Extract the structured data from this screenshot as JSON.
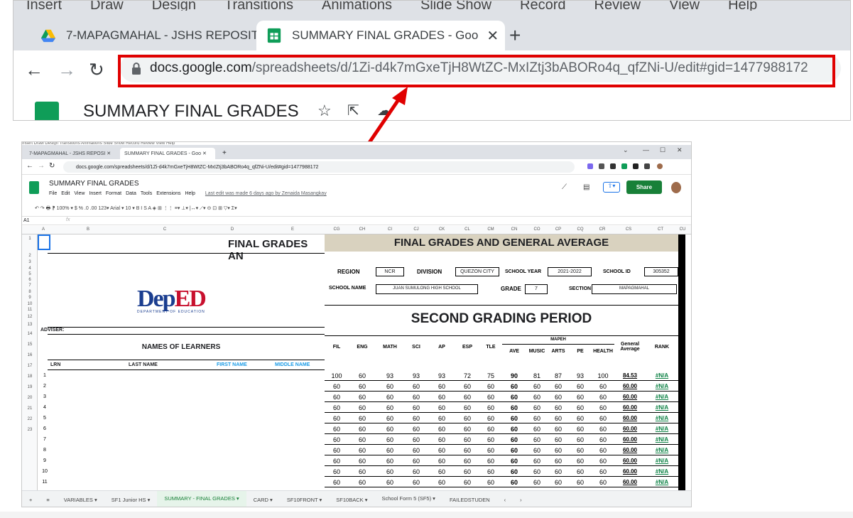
{
  "zoom": {
    "menu_strip": [
      "Insert",
      "Draw",
      "Design",
      "Transitions",
      "Animations",
      "Slide Show",
      "Record",
      "Review",
      "View",
      "Help"
    ],
    "tabs": [
      {
        "label": "7-MAPAGMAHAL - JSHS REPOSIT",
        "close": "✕"
      },
      {
        "label": "SUMMARY FINAL GRADES - Goo",
        "close": "✕"
      }
    ],
    "new_tab": "+",
    "nav": {
      "back": "←",
      "forward": "→",
      "reload": "↻"
    },
    "url_host": "docs.google.com",
    "url_path": "/spreadsheets/d/1Zi-d4k7mGxeTjH8WtZC-MxIZtj3bABORo4q_qfZNi-U/edit#gid=1477988172",
    "doc_title": "SUMMARY FINAL GRADES",
    "doc_icons": [
      "☆",
      "⇱",
      "☁"
    ]
  },
  "shot": {
    "menu_strip": "Insert   Draw   Design   Transitions   Animations   Slide Show   Record   Review   View   Help",
    "tabs": [
      {
        "label": "7-MAPAGMAHAL - JSHS REPOSI ✕"
      },
      {
        "label": "SUMMARY FINAL GRADES - Goo ✕"
      }
    ],
    "window_controls": [
      "⌄",
      "—",
      "☐",
      "✕"
    ],
    "url": "docs.google.com/spreadsheets/d/1Zi-d4k7mGxeTjH8WtZC-MxIZtj3bABORo4q_qfZNi-U/edit#gid=1477988172",
    "doc_title": "SUMMARY FINAL GRADES",
    "menus": [
      "File",
      "Edit",
      "View",
      "Insert",
      "Format",
      "Data",
      "Tools",
      "Extensions",
      "Help"
    ],
    "last_edit": "Last edit was made 6 days ago by Zenaida Masangkay",
    "share": "Share",
    "toolbar": "↶  ↷  🖶  ⁋   100% ▾   $  %  .0  .00  123▾   Arial  ▾   10 ▾   B  I  S  A   ◈  ⊞  ⋮⋮  ≡▾  ⊥▾  |↔▾  ⟋▾   ⊝  ⊡  ⊞  ▽▾  Σ▾",
    "name_box": "A1",
    "fx": "fx",
    "col_headers_left": [
      "A",
      "B",
      "C",
      "D",
      "E"
    ],
    "col_headers_right": [
      "CG",
      "CH",
      "CI",
      "CJ",
      "CK",
      "CL",
      "CM",
      "CN",
      "CO",
      "CP",
      "CQ",
      "CR",
      "CS",
      "CT",
      "CU"
    ],
    "row_headers": [
      "1",
      "2",
      "3",
      "4",
      "5",
      "6",
      "7",
      "8",
      "9",
      "10",
      "11",
      "12",
      "13",
      "14",
      "15",
      "16",
      "17",
      "18",
      "19",
      "20",
      "21",
      "22",
      "23"
    ],
    "left_title": "FINAL GRADES AN",
    "logo_dep": "Dep",
    "logo_ed": "ED",
    "logo_sub": "DEPARTMENT OF EDUCATION",
    "adviser": "ADVISER:",
    "names_header": "NAMES OF LEARNERS",
    "lrn": "LRN",
    "last_name": "LAST NAME",
    "first_name": "FIRST NAME",
    "middle_name": "MIDDLE NAME",
    "student_nums": [
      "1",
      "2",
      "3",
      "4",
      "5",
      "6",
      "7",
      "8",
      "9",
      "10",
      "11"
    ],
    "right_title": "FINAL GRADES AND GENERAL AVERAGE",
    "region_label": "REGION",
    "region": "NCR",
    "division_label": "DIVISION",
    "division": "QUEZON CITY",
    "sy_label": "SCHOOL YEAR",
    "sy": "2021-2022",
    "sid_label": "SCHOOL ID",
    "sid": "305352",
    "school_label": "SCHOOL NAME",
    "school": "JUAN SUMULONG HIGH SCHOOL",
    "grade_label": "GRADE",
    "grade": "7",
    "section_label": "SECTION",
    "section": "MAPAGMAHAL",
    "period": "SECOND GRADING PERIOD",
    "subjects": [
      "FIL",
      "ENG",
      "MATH",
      "SCI",
      "AP",
      "ESP",
      "TLE"
    ],
    "mapeh": "MAPEH",
    "mapeh_sub": [
      "AVE",
      "MUSIC",
      "ARTS",
      "PE",
      "HEALTH"
    ],
    "gen_avg": "General Average",
    "rank": "RANK",
    "grades": [
      [
        "100",
        "60",
        "93",
        "93",
        "93",
        "72",
        "75",
        "90",
        "81",
        "87",
        "93",
        "100",
        "84.53",
        "#N/A"
      ],
      [
        "60",
        "60",
        "60",
        "60",
        "60",
        "60",
        "60",
        "60",
        "60",
        "60",
        "60",
        "60",
        "60.00",
        "#N/A"
      ],
      [
        "60",
        "60",
        "60",
        "60",
        "60",
        "60",
        "60",
        "60",
        "60",
        "60",
        "60",
        "60",
        "60.00",
        "#N/A"
      ],
      [
        "60",
        "60",
        "60",
        "60",
        "60",
        "60",
        "60",
        "60",
        "60",
        "60",
        "60",
        "60",
        "60.00",
        "#N/A"
      ],
      [
        "60",
        "60",
        "60",
        "60",
        "60",
        "60",
        "60",
        "60",
        "60",
        "60",
        "60",
        "60",
        "60.00",
        "#N/A"
      ],
      [
        "60",
        "60",
        "60",
        "60",
        "60",
        "60",
        "60",
        "60",
        "60",
        "60",
        "60",
        "60",
        "60.00",
        "#N/A"
      ],
      [
        "60",
        "60",
        "60",
        "60",
        "60",
        "60",
        "60",
        "60",
        "60",
        "60",
        "60",
        "60",
        "60.00",
        "#N/A"
      ],
      [
        "60",
        "60",
        "60",
        "60",
        "60",
        "60",
        "60",
        "60",
        "60",
        "60",
        "60",
        "60",
        "60.00",
        "#N/A"
      ],
      [
        "60",
        "60",
        "60",
        "60",
        "60",
        "60",
        "60",
        "60",
        "60",
        "60",
        "60",
        "60",
        "60.00",
        "#N/A"
      ],
      [
        "60",
        "60",
        "60",
        "60",
        "60",
        "60",
        "60",
        "60",
        "60",
        "60",
        "60",
        "60",
        "60.00",
        "#N/A"
      ],
      [
        "60",
        "60",
        "60",
        "60",
        "60",
        "60",
        "60",
        "60",
        "60",
        "60",
        "60",
        "60",
        "60.00",
        "#N/A"
      ]
    ],
    "sheet_tabs": [
      "VARIABLES ▾",
      "SF1 Junior HS ▾",
      "SUMMARY - FINAL GRADES ▾",
      "CARD ▾",
      "SF10FRONT ▾",
      "SF10BACK ▾",
      "School Form 5 (SF5) ▾",
      "FAILEDSTUDEN"
    ],
    "active_sheet_index": 2
  },
  "colors": {
    "accent_red": "#e00000",
    "sheets_green": "#0f9d58",
    "share_green": "#188038",
    "rank_green": "#0b8043",
    "title_band": "#d9d2bf"
  }
}
